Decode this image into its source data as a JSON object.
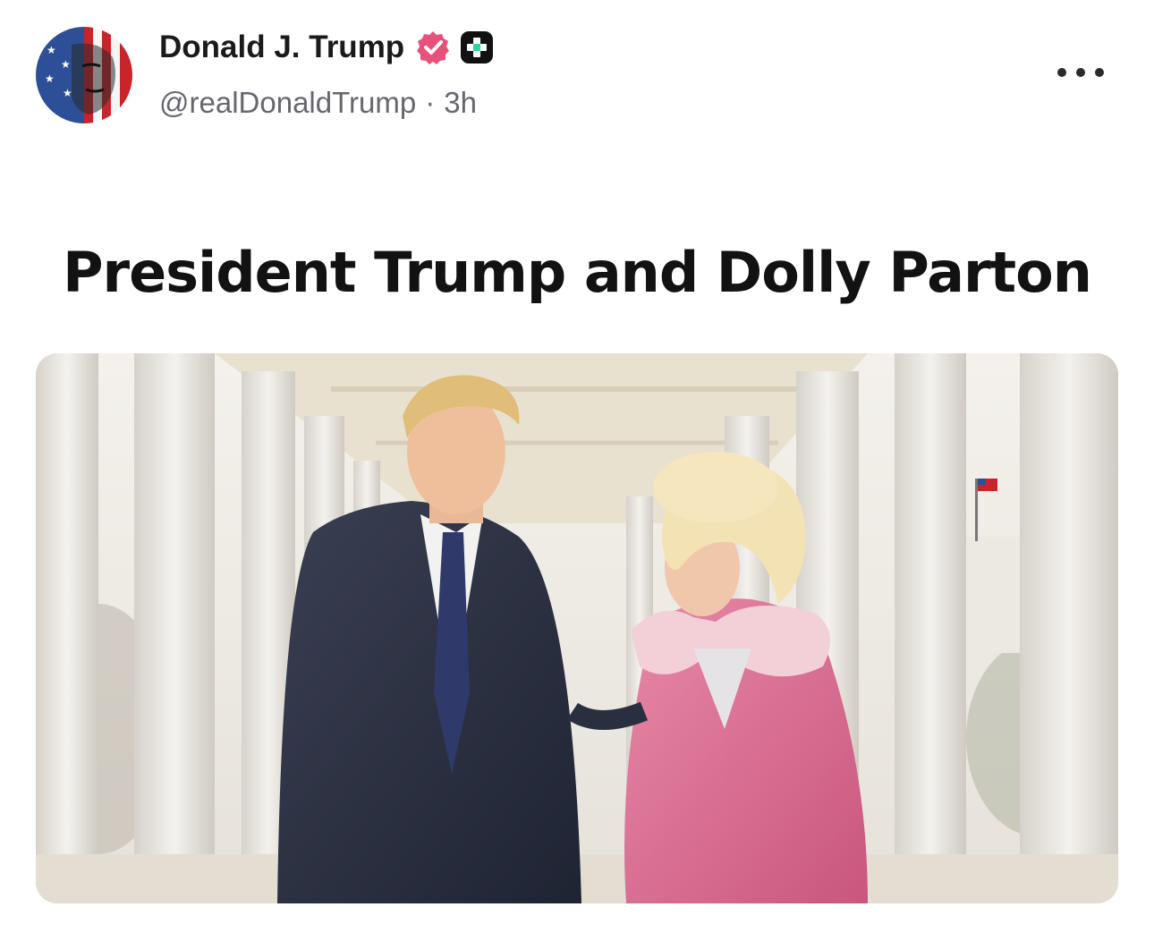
{
  "post": {
    "author": {
      "display_name": "Donald J. Trump",
      "handle": "@realDonaldTrump",
      "separator": "·",
      "time_ago": "3h",
      "avatar_icon": "flag-face-avatar",
      "verified_icon": "verified-badge-icon",
      "badge_icon": "plus-badge-icon"
    },
    "more_icon": "more-options-icon",
    "headline": "President Trump and Dolly Parton",
    "media": {
      "description_icon": "watercolor-portrait-image"
    },
    "colors": {
      "verified": "#e8527a",
      "text_primary": "#1a1a1a",
      "text_secondary": "#66666f"
    }
  }
}
